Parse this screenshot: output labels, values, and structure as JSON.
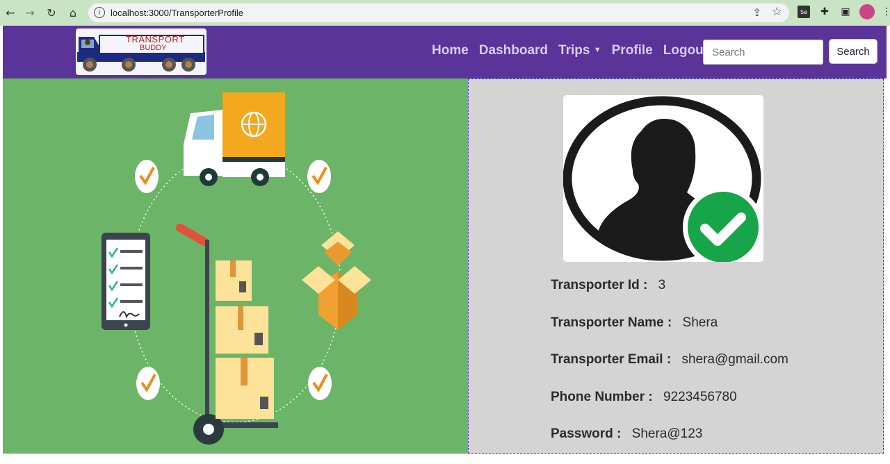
{
  "browser": {
    "url": "localhost:3000/TransporterProfile"
  },
  "navbar": {
    "logo_line1": "TRANSPORT",
    "logo_line2": "BUDDY",
    "links": {
      "home": "Home",
      "dashboard": "Dashboard",
      "trips": "Trips",
      "profile": "Profile",
      "logout": "Logout"
    },
    "search_placeholder": "Search",
    "search_button": "Search",
    "color": "#5a3499"
  },
  "profile": {
    "fields": [
      {
        "label": "Transporter Id :",
        "value": "3"
      },
      {
        "label": "Transporter Name :",
        "value": "Shera"
      },
      {
        "label": "Transporter Email :",
        "value": "shera@gmail.com"
      },
      {
        "label": "Phone Number :",
        "value": "9223456780"
      },
      {
        "label": "Password :",
        "value": "Shera@123"
      }
    ]
  },
  "colors": {
    "left_bg": "#6cb468",
    "right_bg": "#d4d4d4",
    "check_green": "#17a54a"
  }
}
